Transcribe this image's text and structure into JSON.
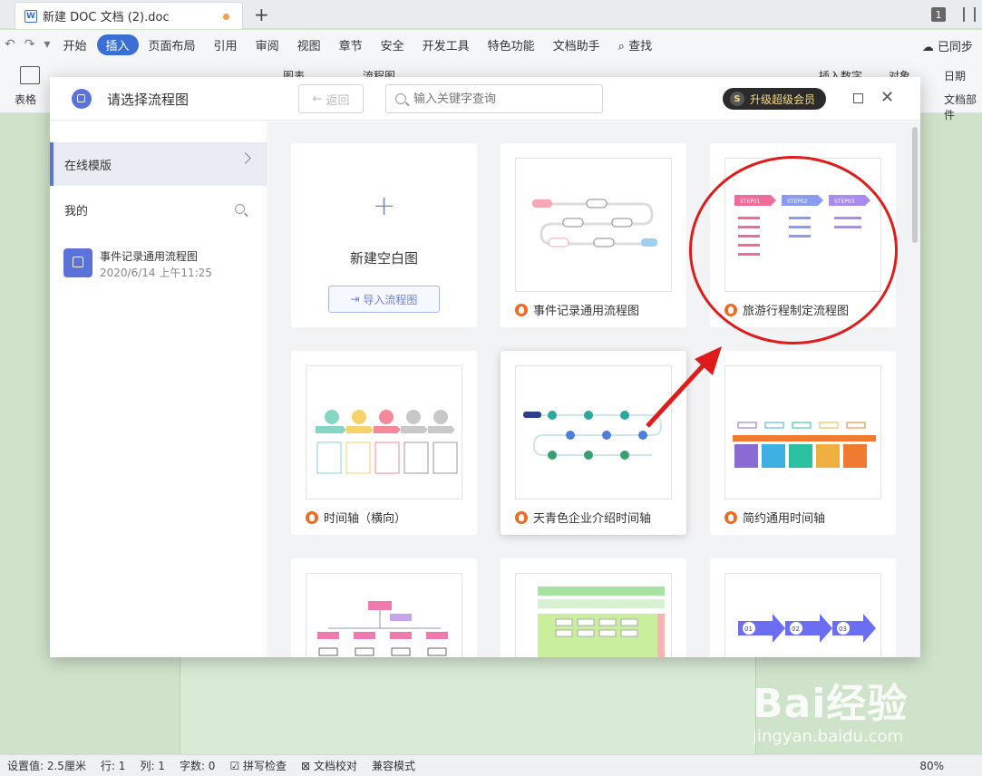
{
  "titlebar": {
    "tab_title": "新建 DOC 文档 (2).doc",
    "new_tab_glyph": "+",
    "window_number": "1"
  },
  "menubar": {
    "items": [
      "开始",
      "插入",
      "页面布局",
      "引用",
      "审阅",
      "视图",
      "章节",
      "安全",
      "开发工具",
      "特色功能",
      "文档助手",
      "查找"
    ],
    "active": "插入",
    "sync_label": "已同步"
  },
  "ribbon": {
    "labels": [
      "表格",
      "图表",
      "流程图",
      "插入数字",
      "对象",
      "日期",
      "文档部件"
    ]
  },
  "dialog": {
    "title": "请选择流程图",
    "back_label": "返回",
    "search_placeholder": "输入关键字查询",
    "vip_label": "升级超级会员",
    "sidebar": {
      "online": "在线模版",
      "mine": "我的",
      "recent_name": "事件记录通用流程图",
      "recent_date": "2020/6/14 上午11:25"
    },
    "new_blank": {
      "label": "新建空白图",
      "import_label": "导入流程图"
    },
    "templates": [
      {
        "title": "事件记录通用流程图"
      },
      {
        "title": "旅游行程制定流程图"
      },
      {
        "title": "时间轴（横向）"
      },
      {
        "title": "天青色企业介绍时间轴"
      },
      {
        "title": "简约通用时间轴"
      },
      {
        "title": ""
      },
      {
        "title": ""
      },
      {
        "title": ""
      }
    ],
    "thumb_texts": {
      "steps": [
        "STEP01",
        "STEP02",
        "STEP03"
      ],
      "arrows": [
        "01",
        "02",
        "03"
      ]
    }
  },
  "statusbar": {
    "items": [
      "设置值: 2.5厘米",
      "行: 1",
      "列: 1",
      "字数: 0",
      "拼写检查",
      "文档校对",
      "兼容模式"
    ],
    "zoom": "80%"
  },
  "watermark": {
    "brand": "Bai经验",
    "url": "jingyan.baidu.com"
  },
  "colors": {
    "accent": "#3a6fd6",
    "dialog_accent": "#5b72d8",
    "flame": "#f06a23",
    "annotation": "#e01b1b"
  }
}
